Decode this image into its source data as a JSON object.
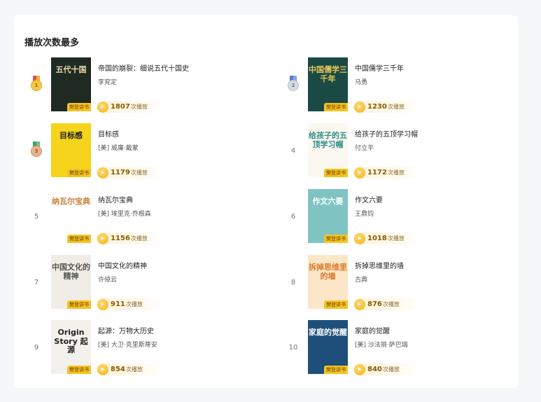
{
  "section": {
    "title": "播放次数最多"
  },
  "tag_label": "樊登讲书",
  "play_suffix": "次播放",
  "books": [
    {
      "rank": "1",
      "medal": "gold",
      "title": "帝国的崩裂：细说五代十国史",
      "author": "李兖定",
      "plays": "1807",
      "cover_text": "五代十国",
      "cover_bg": "#1f2a22",
      "cover_fg": "#e9d9b0"
    },
    {
      "rank": "2",
      "medal": "silver",
      "title": "中国儒学三千年",
      "author": "马勇",
      "plays": "1230",
      "cover_text": "中国儒学三千年",
      "cover_bg": "#1b4a45",
      "cover_fg": "#e8c85a"
    },
    {
      "rank": "3",
      "medal": "bronze",
      "title": "目标感",
      "author": "[美] 威廉·戴蒙",
      "plays": "1179",
      "cover_text": "目标感",
      "cover_bg": "#f6d41c",
      "cover_fg": "#222"
    },
    {
      "rank": "4",
      "medal": "",
      "title": "给孩子的五顶学习帽",
      "author": "付立平",
      "plays": "1172",
      "cover_text": "给孩子的五顶学习帽",
      "cover_bg": "#fbf8ef",
      "cover_fg": "#2e8d8a"
    },
    {
      "rank": "5",
      "medal": "",
      "title": "纳瓦尔宝典",
      "author": "[美] 埃里克·乔根森",
      "plays": "1156",
      "cover_text": "纳瓦尔宝典",
      "cover_bg": "#ffffff",
      "cover_fg": "#c8823a"
    },
    {
      "rank": "6",
      "medal": "",
      "title": "作文六要",
      "author": "王鼎钧",
      "plays": "1018",
      "cover_text": "作文六要",
      "cover_bg": "#7fc4c2",
      "cover_fg": "#ffffff"
    },
    {
      "rank": "7",
      "medal": "",
      "title": "中国文化的精神",
      "author": "许倬云",
      "plays": "911",
      "cover_text": "中国文化的精神",
      "cover_bg": "#efede6",
      "cover_fg": "#555"
    },
    {
      "rank": "8",
      "medal": "",
      "title": "拆掉思维里的墙",
      "author": "古典",
      "plays": "876",
      "cover_text": "拆掉思维里的墙",
      "cover_bg": "#fbe7c7",
      "cover_fg": "#e1782a"
    },
    {
      "rank": "9",
      "medal": "",
      "title": "起源：万物大历史",
      "author": "[美] 大卫·克里斯蒂安",
      "plays": "854",
      "cover_text": "Origin Story 起源",
      "cover_bg": "#f3f1ec",
      "cover_fg": "#222"
    },
    {
      "rank": "10",
      "medal": "",
      "title": "家庭的觉醒",
      "author": "[美] 沙法丽·萨巴瑞",
      "plays": "840",
      "cover_text": "家庭的觉醒",
      "cover_bg": "#1e4f7a",
      "cover_fg": "#ffffff"
    }
  ]
}
